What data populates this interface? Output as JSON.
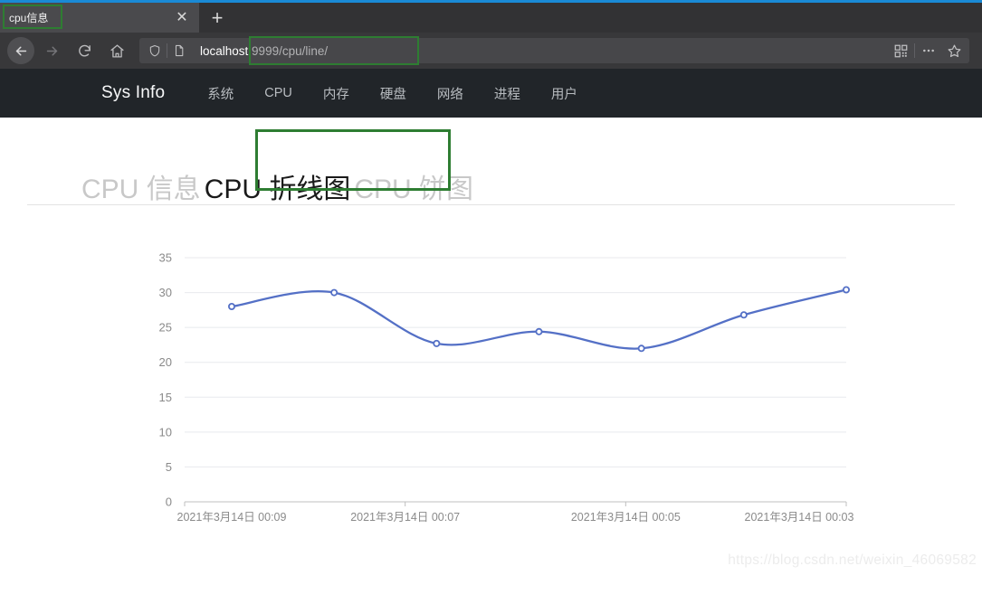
{
  "browser": {
    "tab": {
      "title": "cpu信息",
      "close_label": "✕",
      "highlight_color": "#2e7d32"
    },
    "newtab_label": "+",
    "nav": {
      "back": "back-arrow",
      "forward": "forward-arrow",
      "reload": "reload-arrow",
      "home": "home-house"
    },
    "url": {
      "host": "localhost",
      "rest": ":9999/cpu/line/",
      "full": "localhost:9999/cpu/line/",
      "shield_icon": "shield-icon",
      "page_icon": "page-icon",
      "qr_icon": "qr-code-icon",
      "menu_icon": "ellipsis-icon",
      "star_icon": "star-icon"
    }
  },
  "site": {
    "brand": "Sys Info",
    "nav_items": [
      {
        "label": "系统"
      },
      {
        "label": "CPU"
      },
      {
        "label": "内存"
      },
      {
        "label": "硬盘"
      },
      {
        "label": "网络"
      },
      {
        "label": "进程"
      },
      {
        "label": "用户"
      }
    ]
  },
  "page_tabs": [
    {
      "label": "CPU 信息",
      "active": false
    },
    {
      "label": "CPU 折线图",
      "active": true
    },
    {
      "label": "CPU 饼图",
      "active": false
    }
  ],
  "watermark": "https://blog.csdn.net/weixin_46069582",
  "chart_data": {
    "type": "line",
    "title": "",
    "xlabel": "",
    "ylabel": "",
    "line_color": "#5470c6",
    "grid": true,
    "legend": "none",
    "ylim": [
      0,
      35
    ],
    "yticks": [
      0,
      5,
      10,
      15,
      20,
      25,
      30,
      35
    ],
    "ytick_labels": [
      "0",
      "5",
      "10",
      "15",
      "20",
      "25",
      "30",
      "35"
    ],
    "x": [
      "2021年3月14日 00:09",
      "",
      "2021年3月14日 00:07",
      "",
      "2021年3月14日 00:05",
      "",
      "2021年3月14日 00:03"
    ],
    "xtick_labels": [
      "2021年3月14日 00:09",
      "2021年3月14日 00:07",
      "2021年3月14日 00:05",
      "2021年3月14日 00:03"
    ],
    "values": [
      28.0,
      30.0,
      22.7,
      24.4,
      22.0,
      26.8,
      30.4
    ]
  }
}
